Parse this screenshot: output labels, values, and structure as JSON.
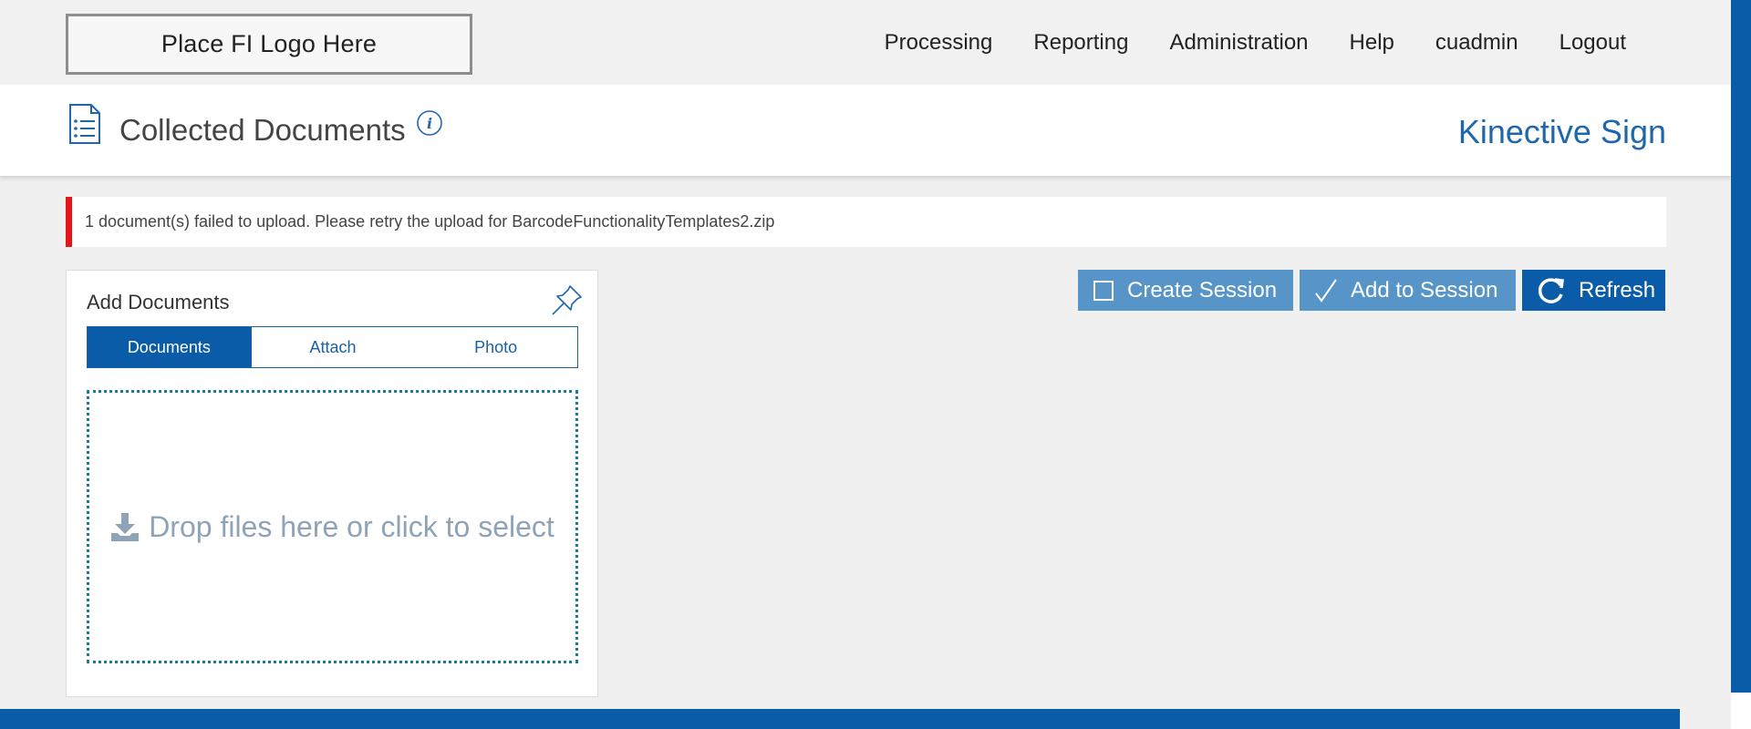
{
  "header": {
    "logo_text": "Place FI Logo Here",
    "nav": [
      {
        "label": "Processing"
      },
      {
        "label": "Reporting"
      },
      {
        "label": "Administration"
      },
      {
        "label": "Help"
      },
      {
        "label": "cuadmin"
      },
      {
        "label": "Logout"
      }
    ]
  },
  "titlebar": {
    "page_title": "Collected Documents",
    "info_icon": "info-icon",
    "doc_icon": "document-list-icon",
    "brand": "Kinective Sign"
  },
  "alert": {
    "message": "1 document(s) failed to upload. Please retry the upload for BarcodeFunctionalityTemplates2.zip",
    "color": "#e3161b"
  },
  "actions": {
    "create_session": "Create Session",
    "add_to_session": "Add to Session",
    "refresh": "Refresh"
  },
  "panel": {
    "title": "Add Documents",
    "pin_icon": "pin-icon",
    "tabs": [
      {
        "label": "Documents",
        "active": true
      },
      {
        "label": "Attach",
        "active": false
      },
      {
        "label": "Photo",
        "active": false
      }
    ],
    "dropzone_text": "Drop files here or click to select"
  },
  "colors": {
    "primary": "#0a5ba8",
    "button_light": "#5795c8",
    "brand_text": "#1f67ad",
    "dropzone_text": "#8fa3b8"
  }
}
